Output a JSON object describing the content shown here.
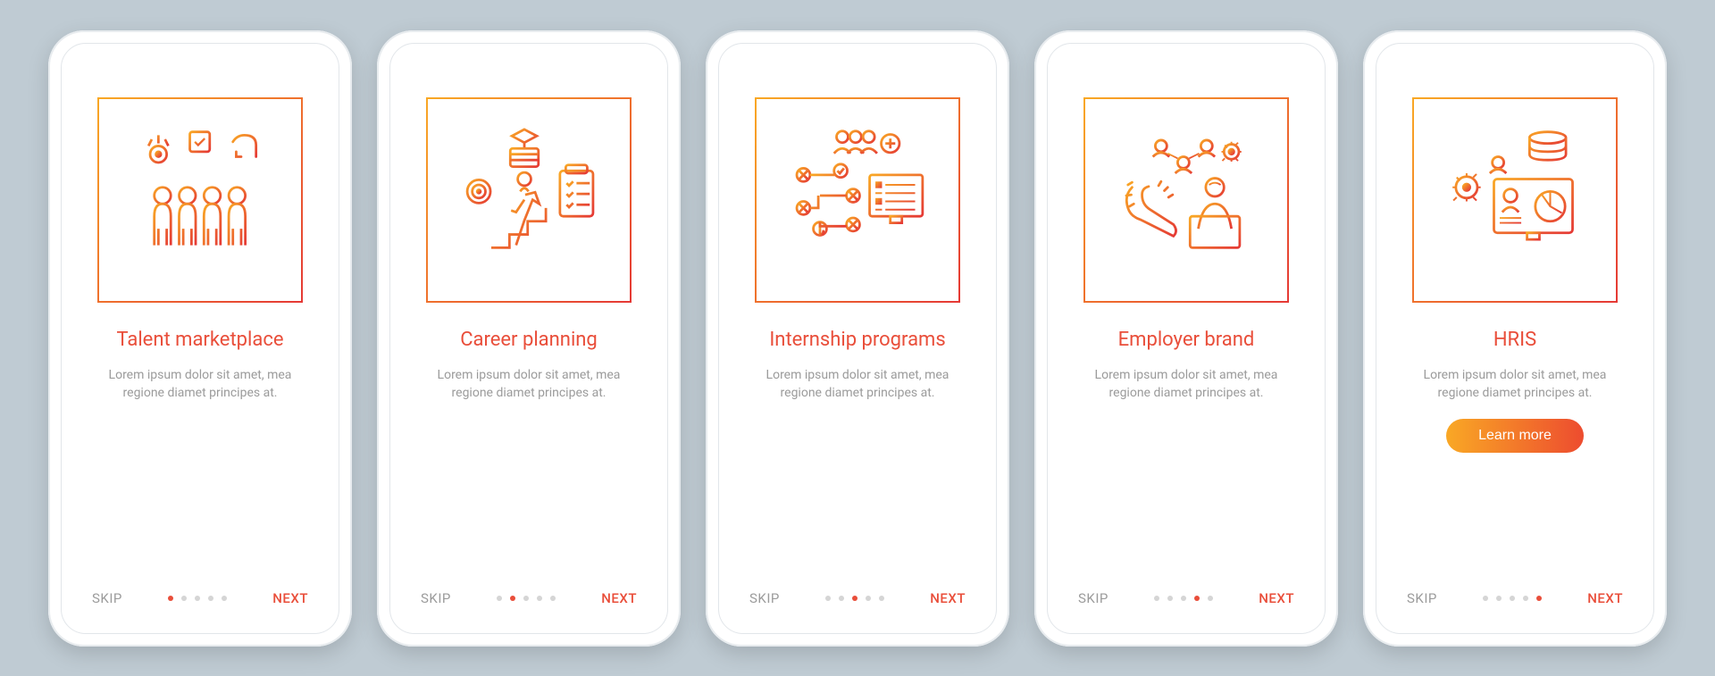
{
  "common": {
    "skip_label": "SKIP",
    "next_label": "NEXT",
    "description": "Lorem ipsum dolor sit amet, mea regione diamet principes at.",
    "learn_more_label": "Learn more",
    "dot_count": 5
  },
  "screens": [
    {
      "title": "Talent marketplace",
      "active_dot": 0,
      "illustration": "talent-marketplace",
      "has_learn_more": false
    },
    {
      "title": "Career planning",
      "active_dot": 1,
      "illustration": "career-planning",
      "has_learn_more": false
    },
    {
      "title": "Internship programs",
      "active_dot": 2,
      "illustration": "internship-programs",
      "has_learn_more": false
    },
    {
      "title": "Employer brand",
      "active_dot": 3,
      "illustration": "employer-brand",
      "has_learn_more": false
    },
    {
      "title": "HRIS",
      "active_dot": 4,
      "illustration": "hris",
      "has_learn_more": true
    }
  ]
}
